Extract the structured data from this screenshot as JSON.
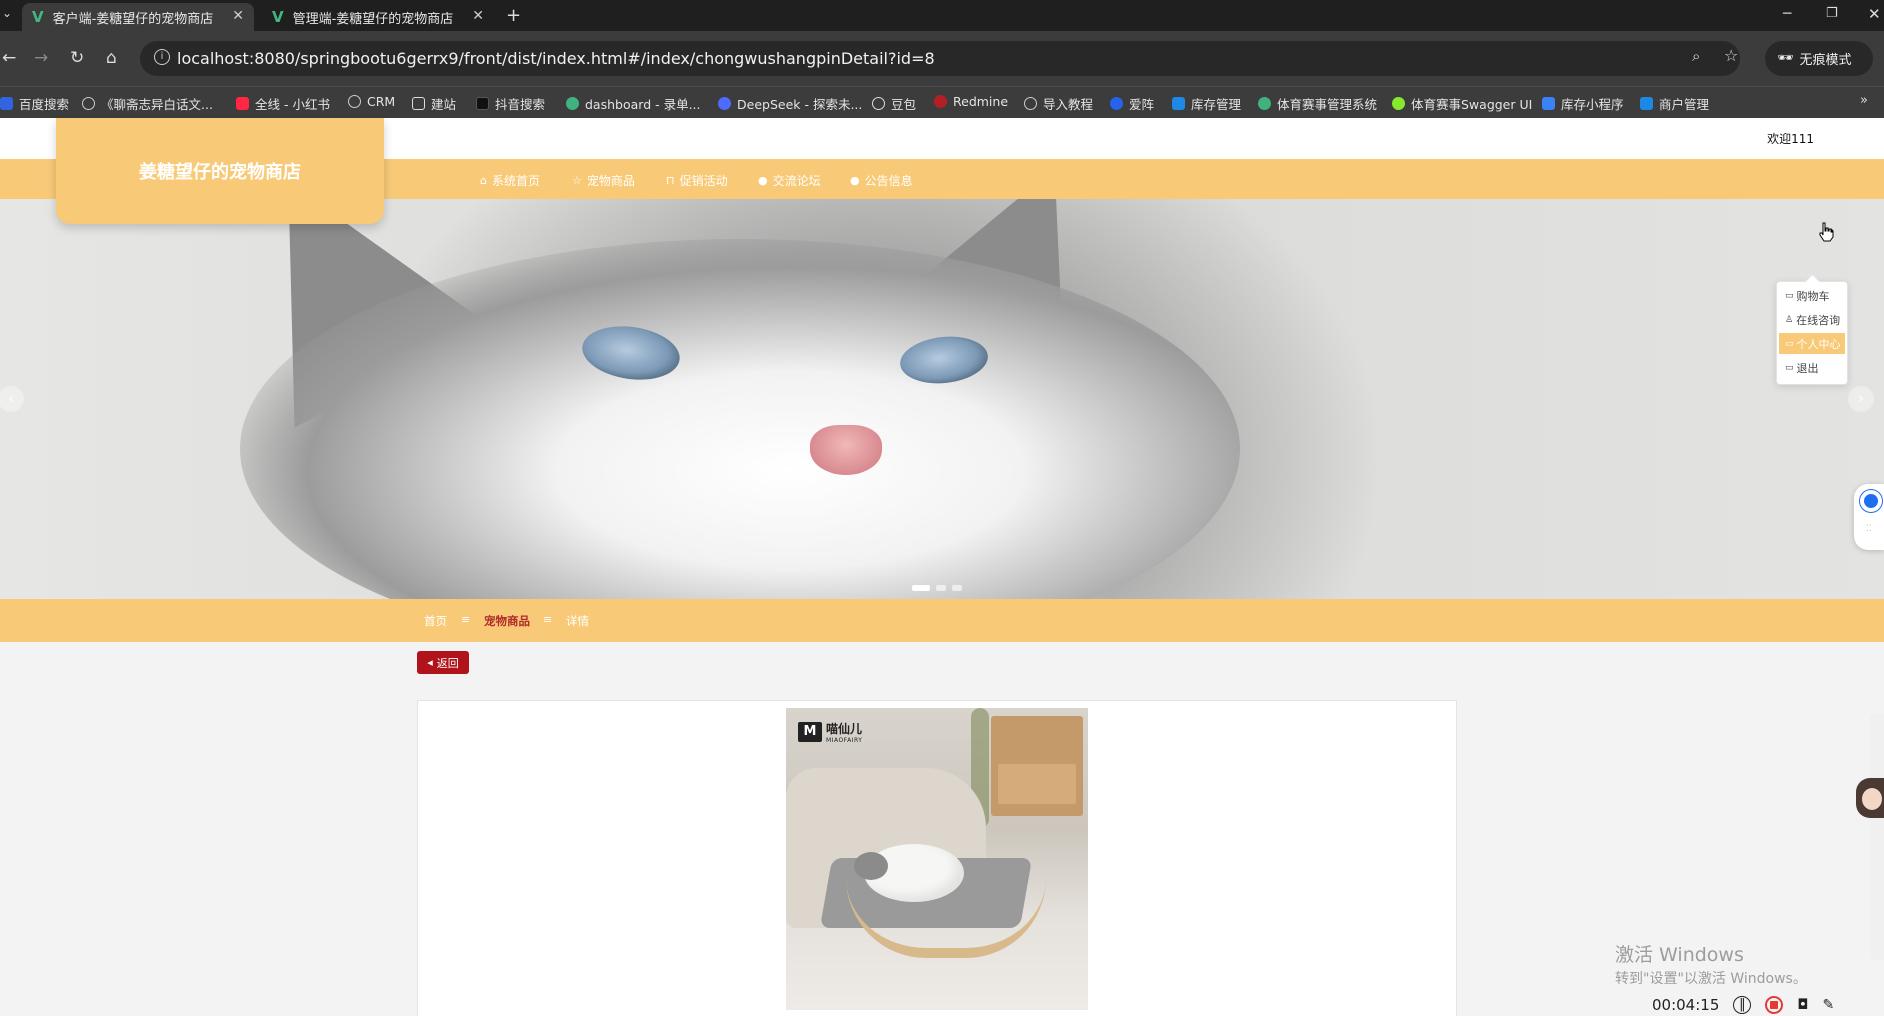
{
  "browser": {
    "tabs": [
      {
        "title": "客户端-姜糖望仔的宠物商店",
        "active": true
      },
      {
        "title": "管理端-姜糖望仔的宠物商店",
        "active": false
      }
    ],
    "url": "localhost:8080/springbootu6gerrx9/front/dist/index.html#/index/chongwushangpinDetail?id=8",
    "incognito_label": "无痕模式",
    "bookmarks": [
      "百度搜索",
      "《聊斋志异白话文...",
      "全线 - 小红书",
      "CRM",
      "建站",
      "抖音搜索",
      "dashboard - 录单...",
      "DeepSeek - 探索未...",
      "豆包",
      "Redmine",
      "导入教程",
      "爱阵",
      "库存管理",
      "体育赛事管理系统",
      "体育赛事Swagger UI",
      "库存小程序",
      "商户管理"
    ]
  },
  "site": {
    "logo": "姜糖望仔的宠物商店",
    "welcome": "欢迎111",
    "nav": [
      {
        "label": "系统首页",
        "icon": "home-icon"
      },
      {
        "label": "宠物商品",
        "icon": "star-icon"
      },
      {
        "label": "促销活动",
        "icon": "lock-icon"
      },
      {
        "label": "交流论坛",
        "icon": "dot-icon"
      },
      {
        "label": "公告信息",
        "icon": "dot-icon"
      }
    ],
    "dropdown": [
      {
        "label": "购物车",
        "icon": "cart-icon"
      },
      {
        "label": "在线咨询",
        "icon": "user-icon"
      },
      {
        "label": "个人中心",
        "icon": "profile-icon",
        "hovered": true
      },
      {
        "label": "退出",
        "icon": "logout-icon"
      }
    ],
    "breadcrumb": {
      "items": [
        "首页",
        "宠物商品",
        "详情"
      ],
      "separator": "≡"
    },
    "back_label": "返回",
    "product_brand": {
      "name": "喵仙儿",
      "sub": "MIAOFAIRY"
    }
  },
  "overlay": {
    "watermark_title": "激活 Windows",
    "watermark_sub": "转到\"设置\"以激活 Windows。",
    "recorder_time": "00:04:15"
  },
  "colors": {
    "accent": "#f8ca78",
    "back_button": "#b0141a",
    "breadcrumb_current": "#b12a2a"
  }
}
